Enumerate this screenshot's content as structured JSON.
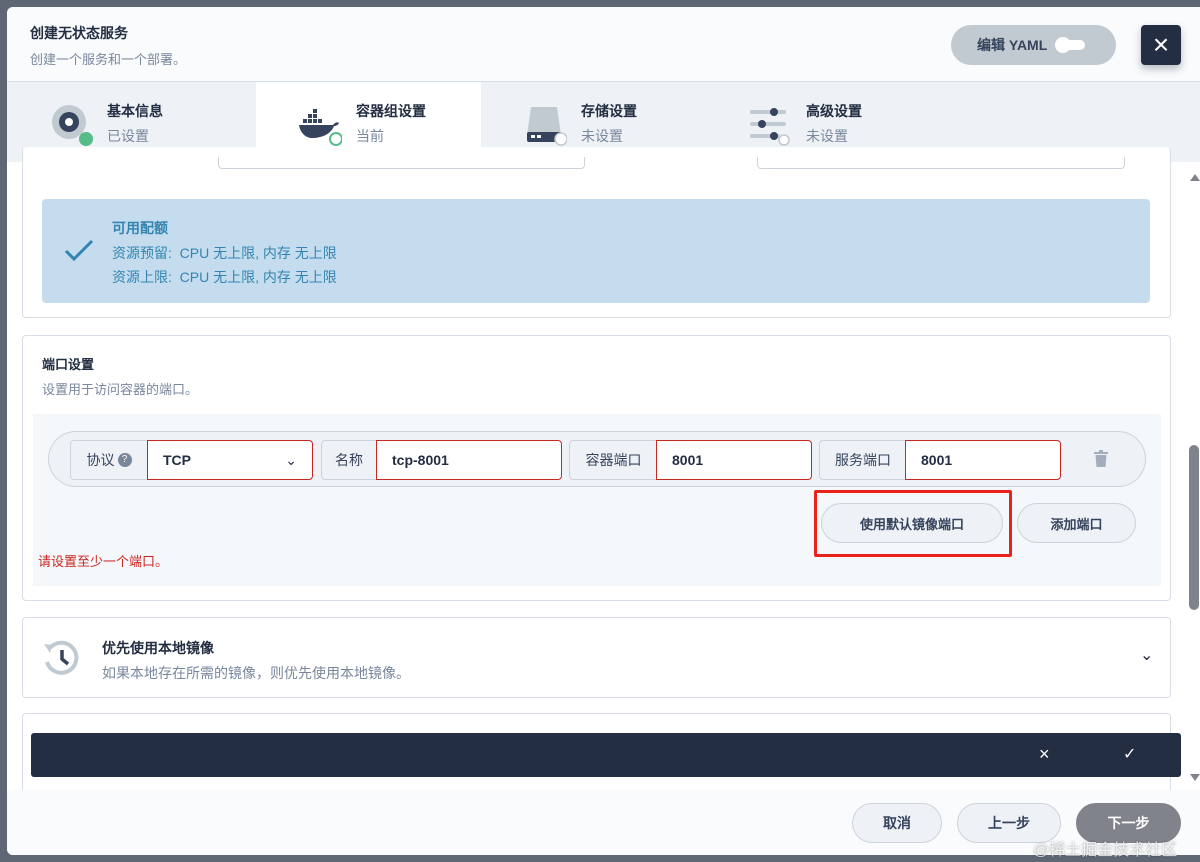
{
  "header": {
    "title": "创建无状态服务",
    "subtitle": "创建一个服务和一个部署。",
    "yaml_label": "编辑 YAML",
    "close": "×"
  },
  "steps": [
    {
      "title": "基本信息",
      "status": "已设置",
      "icon": "disk-icon",
      "state": "done"
    },
    {
      "title": "容器组设置",
      "status": "当前",
      "icon": "docker-icon",
      "state": "current"
    },
    {
      "title": "存储设置",
      "status": "未设置",
      "icon": "storage-icon",
      "state": "pending"
    },
    {
      "title": "高级设置",
      "status": "未设置",
      "icon": "sliders-icon",
      "state": "pending"
    }
  ],
  "quota": {
    "title": "可用配额",
    "reserve": "资源预留:  CPU 无上限, 内存 无上限",
    "limit": "资源上限:  CPU 无上限, 内存 无上限"
  },
  "ports": {
    "title": "端口设置",
    "desc": "设置用于访问容器的端口。",
    "protocol_label": "协议",
    "protocol_value": "TCP",
    "name_label": "名称",
    "name_value": "tcp-8001",
    "container_port_label": "容器端口",
    "container_port_value": "8001",
    "service_port_label": "服务端口",
    "service_port_value": "8001",
    "use_default_label": "使用默认镜像端口",
    "add_label": "添加端口",
    "error": "请设置至少一个端口。"
  },
  "local_image": {
    "title": "优先使用本地镜像",
    "desc": "如果本地存在所需的镜像，则优先使用本地镜像。"
  },
  "bar": {
    "cancel": "×",
    "confirm": "✓"
  },
  "footer": {
    "cancel": "取消",
    "prev": "上一步",
    "next": "下一步"
  },
  "watermark": "@稀土掘金技术社区",
  "colors": {
    "accent": "#242e42",
    "error": "#ca2621",
    "success": "#55bc8a",
    "info": "#3385b0"
  }
}
